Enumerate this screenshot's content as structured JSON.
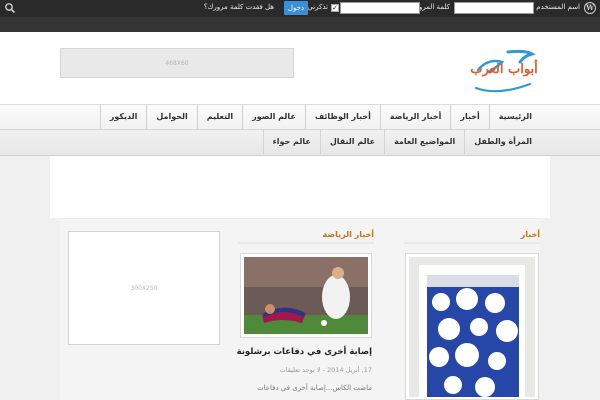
{
  "adminbar": {
    "username_label": "اسم المستخدم",
    "password_label": "كلمة المرور",
    "remember_label": "تذكرني",
    "remember_check": "✓",
    "login_button": "دخول",
    "lost_password": "هل فقدت كلمة مرورك؟",
    "wp_logo": "W"
  },
  "header": {
    "ad_banner": "468X60",
    "logo_text": "أبواب العرب"
  },
  "nav": {
    "row1": [
      "الرئيسية",
      "أخبار",
      "أخبار الرياضة",
      "أخبار الوظائف",
      "عالم الصور",
      "التعليم",
      "الحوامل",
      "الديكور"
    ],
    "row2": [
      "المرأة والطفل",
      "المواضيع العامة",
      "عالم النقال",
      "عالم حواء"
    ]
  },
  "content": {
    "ad_box": "300X250",
    "col_news_title": "أخبار",
    "col_sport_title": "أخبار الرياضة",
    "post_title": "إصابة أخرى في دفاعات برشلونة",
    "post_meta": "17, أبريل 2014 - لا يوجد تعليقات",
    "post_excerpt": "ماضت الكاس...إصابة أخرى في دفاعات"
  },
  "colors": {
    "accent": "#c0741d",
    "login_button": "#3a8fd6",
    "adminbar_bg": "#2a2a2a"
  }
}
